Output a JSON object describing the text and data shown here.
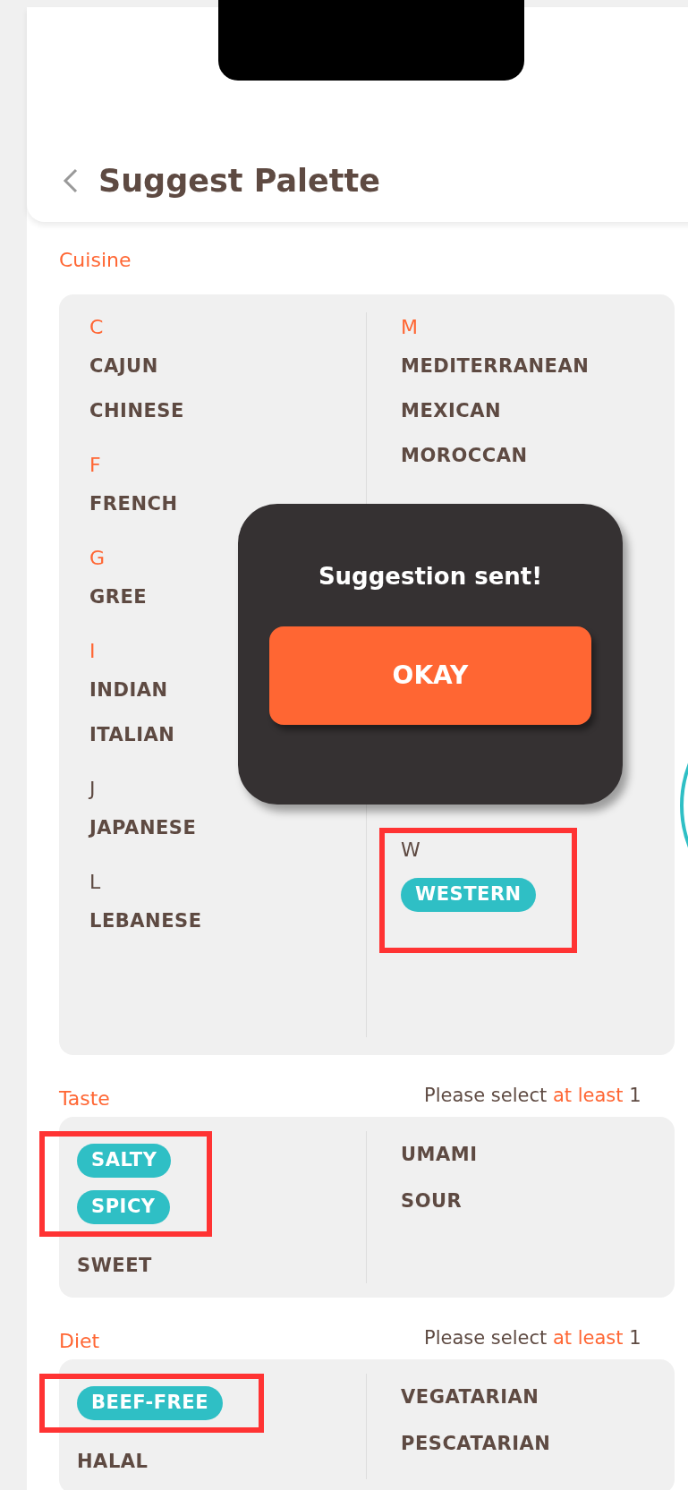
{
  "header": {
    "title": "Suggest Palette"
  },
  "cuisine": {
    "label": "Cuisine",
    "columns": [
      [
        {
          "letter": "C",
          "highlighted": true,
          "items": [
            {
              "label": "CAJUN",
              "selected": false,
              "annotated": false
            },
            {
              "label": "CHINESE",
              "selected": false,
              "annotated": false
            }
          ]
        },
        {
          "letter": "F",
          "highlighted": true,
          "items": [
            {
              "label": "FRENCH",
              "selected": false,
              "annotated": false
            }
          ]
        },
        {
          "letter": "G",
          "highlighted": true,
          "items": [
            {
              "label": "GREE",
              "selected": false,
              "annotated": false
            }
          ]
        },
        {
          "letter": "I",
          "highlighted": true,
          "items": [
            {
              "label": "INDIAN",
              "selected": false,
              "annotated": false
            },
            {
              "label": "ITALIAN",
              "selected": false,
              "annotated": false
            }
          ]
        },
        {
          "letter": "J",
          "highlighted": false,
          "items": [
            {
              "label": "JAPANESE",
              "selected": false,
              "annotated": false
            }
          ]
        },
        {
          "letter": "L",
          "highlighted": false,
          "items": [
            {
              "label": "LEBANESE",
              "selected": false,
              "annotated": false
            }
          ]
        }
      ],
      [
        {
          "letter": "M",
          "highlighted": true,
          "items": [
            {
              "label": "MEDITERRANEAN",
              "selected": false,
              "annotated": false
            },
            {
              "label": "MEXICAN",
              "selected": false,
              "annotated": false
            },
            {
              "label": "MOROCCAN",
              "selected": false,
              "annotated": false
            }
          ]
        },
        {
          "letter": "W",
          "highlighted": false,
          "items": [
            {
              "label": "WESTERN",
              "selected": true,
              "annotated": true
            }
          ]
        }
      ]
    ]
  },
  "sections": [
    {
      "label": "Taste",
      "hint": {
        "text": "Please select",
        "emphasis": "at least",
        "tail": "1"
      },
      "columns": [
        [
          {
            "label": "SALTY",
            "selected": true,
            "annotated": true
          },
          {
            "label": "SPICY",
            "selected": true,
            "annotated": true
          },
          {
            "label": "SWEET",
            "selected": false,
            "annotated": false
          }
        ],
        [
          {
            "label": "UMAMI",
            "selected": false,
            "annotated": false
          },
          {
            "label": "SOUR",
            "selected": false,
            "annotated": false
          }
        ]
      ]
    },
    {
      "label": "Diet",
      "hint": {
        "text": "Please select",
        "emphasis": "at least",
        "tail": "1"
      },
      "columns": [
        [
          {
            "label": "BEEF-FREE",
            "selected": true,
            "annotated": true
          },
          {
            "label": "HALAL",
            "selected": false,
            "annotated": false
          }
        ],
        [
          {
            "label": "VEGATARIAN",
            "selected": false,
            "annotated": false
          },
          {
            "label": "PESCATARIAN",
            "selected": false,
            "annotated": false
          }
        ]
      ]
    }
  ],
  "dialog": {
    "message": "Suggestion sent!",
    "button": "OKAY"
  }
}
